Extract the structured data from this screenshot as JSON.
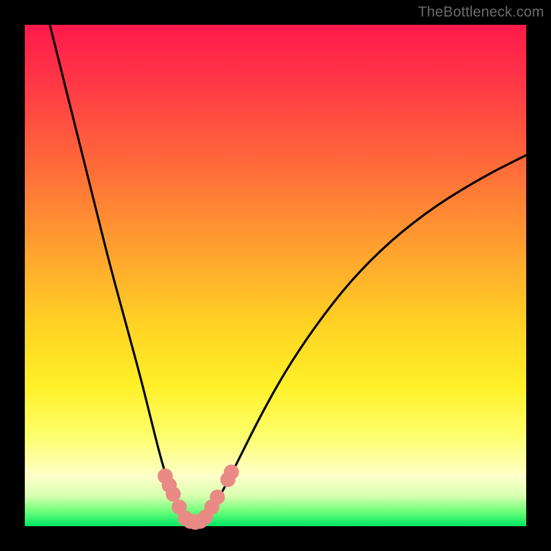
{
  "watermark": "TheBottleneck.com",
  "chart_data": {
    "type": "line",
    "title": "",
    "xlabel": "",
    "ylabel": "",
    "xlim": [
      0,
      100
    ],
    "ylim": [
      0,
      100
    ],
    "series": [
      {
        "name": "left-curve",
        "x": [
          5,
          8,
          11,
          14,
          17,
          20,
          23,
          25,
          27,
          28.5,
          30,
          31,
          32,
          33
        ],
        "y": [
          100,
          88,
          76,
          64,
          52,
          41,
          30,
          22,
          14,
          9,
          5,
          3,
          1.5,
          0.5
        ]
      },
      {
        "name": "right-curve",
        "x": [
          35,
          36.5,
          38,
          40,
          43,
          47,
          52,
          58,
          65,
          73,
          82,
          92,
          100
        ],
        "y": [
          0.5,
          2,
          4.5,
          8,
          14,
          22,
          31,
          40,
          49,
          57,
          64,
          70,
          74
        ]
      }
    ],
    "markers": [
      {
        "group": "left-dots",
        "x": 28.0,
        "y": 10.0
      },
      {
        "group": "left-dots",
        "x": 28.8,
        "y": 8.2
      },
      {
        "group": "left-dots",
        "x": 29.6,
        "y": 6.4
      },
      {
        "group": "left-dots",
        "x": 30.8,
        "y": 3.8
      },
      {
        "group": "valley-dots",
        "x": 32.0,
        "y": 1.6
      },
      {
        "group": "valley-dots",
        "x": 33.0,
        "y": 1.0
      },
      {
        "group": "valley-dots",
        "x": 34.0,
        "y": 0.8
      },
      {
        "group": "valley-dots",
        "x": 35.0,
        "y": 1.0
      },
      {
        "group": "valley-dots",
        "x": 36.0,
        "y": 1.8
      },
      {
        "group": "right-dots",
        "x": 37.3,
        "y": 3.8
      },
      {
        "group": "right-dots",
        "x": 38.4,
        "y": 5.8
      },
      {
        "group": "right-dots",
        "x": 40.5,
        "y": 9.3
      },
      {
        "group": "right-dots",
        "x": 41.2,
        "y": 10.8
      }
    ],
    "colors": {
      "curve": "#000000",
      "marker": "#e98b84",
      "background_top": "#ff1a4b",
      "background_bottom": "#00e765"
    }
  }
}
